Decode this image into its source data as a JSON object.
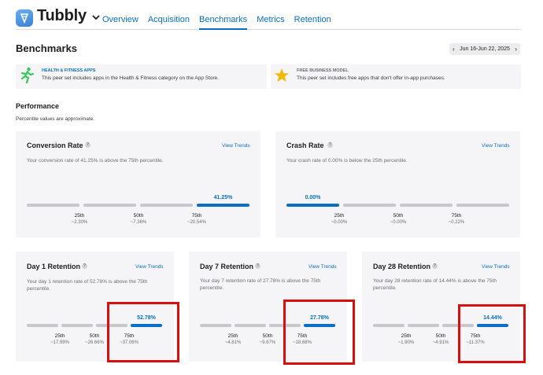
{
  "app": {
    "name": "Tubbly"
  },
  "nav": {
    "tabs": [
      "Overview",
      "Acquisition",
      "Benchmarks",
      "Metrics",
      "Retention"
    ],
    "active": "Benchmarks"
  },
  "header": {
    "title": "Benchmarks",
    "date_range": "Jun 16-Jun 22, 2025"
  },
  "peer_sets": [
    {
      "title": "HEALTH & FITNESS APPS",
      "description": "This peer set includes apps in the Health & Fitness category on the App Store.",
      "icon": "running-figure-icon"
    },
    {
      "title": "FREE BUSINESS MODEL",
      "description": "This peer set includes free apps that don't offer in-app purchases.",
      "icon": "star-icon"
    }
  ],
  "performance": {
    "title": "Performance",
    "note": "Percentile values are approximate."
  },
  "common": {
    "help": "?",
    "view_trends": "View Trends"
  },
  "cards": {
    "conversion": {
      "title": "Conversion Rate",
      "description": "Your conversion rate of 41.25% is above the 75th percentile.",
      "value": "41.25%",
      "percentiles": [
        {
          "label": "25th",
          "value": "~2.30%"
        },
        {
          "label": "50th",
          "value": "~7.36%"
        },
        {
          "label": "75th",
          "value": "~20.54%"
        }
      ]
    },
    "crash": {
      "title": "Crash Rate",
      "description": "Your crash rate of 0.00% is below the 25th percentile.",
      "value": "0.00%",
      "percentiles": [
        {
          "label": "25th",
          "value": "~0.00%"
        },
        {
          "label": "50th",
          "value": "~0.00%"
        },
        {
          "label": "75th",
          "value": "~0.22%"
        }
      ]
    },
    "day1": {
      "title": "Day 1 Retention",
      "description": "Your day 1 retention rate of 52.78% is above the 75th percentile.",
      "value": "52.78%",
      "percentiles": [
        {
          "label": "25th",
          "value": "~17.99%"
        },
        {
          "label": "50th",
          "value": "~26.66%"
        },
        {
          "label": "75th",
          "value": "~37.06%"
        }
      ]
    },
    "day7": {
      "title": "Day 7 Retention",
      "description_line1": "Your day 7 retention rate of 27.78% is above the 75th",
      "description_line2": "percentile.",
      "value": "27.78%",
      "percentiles": [
        {
          "label": "25th",
          "value": "~4.81%"
        },
        {
          "label": "50th",
          "value": "~9.67%"
        },
        {
          "label": "75th",
          "value": "~18.68%"
        }
      ]
    },
    "day28": {
      "title": "Day 28 Retention",
      "description_line1": "Your day 28 retention rate of 14.44% is above the 75th",
      "description_line2": "percentile.",
      "value": "14.44%",
      "percentiles": [
        {
          "label": "25th",
          "value": "~1.90%"
        },
        {
          "label": "50th",
          "value": "~4.91%"
        },
        {
          "label": "75th",
          "value": "~11.37%"
        }
      ]
    }
  },
  "colors": {
    "accent": "#0a6fc4",
    "annotation": "#d70f0f",
    "card_bg": "#f5f5f7",
    "bar_gray": "#c7c7cc"
  }
}
